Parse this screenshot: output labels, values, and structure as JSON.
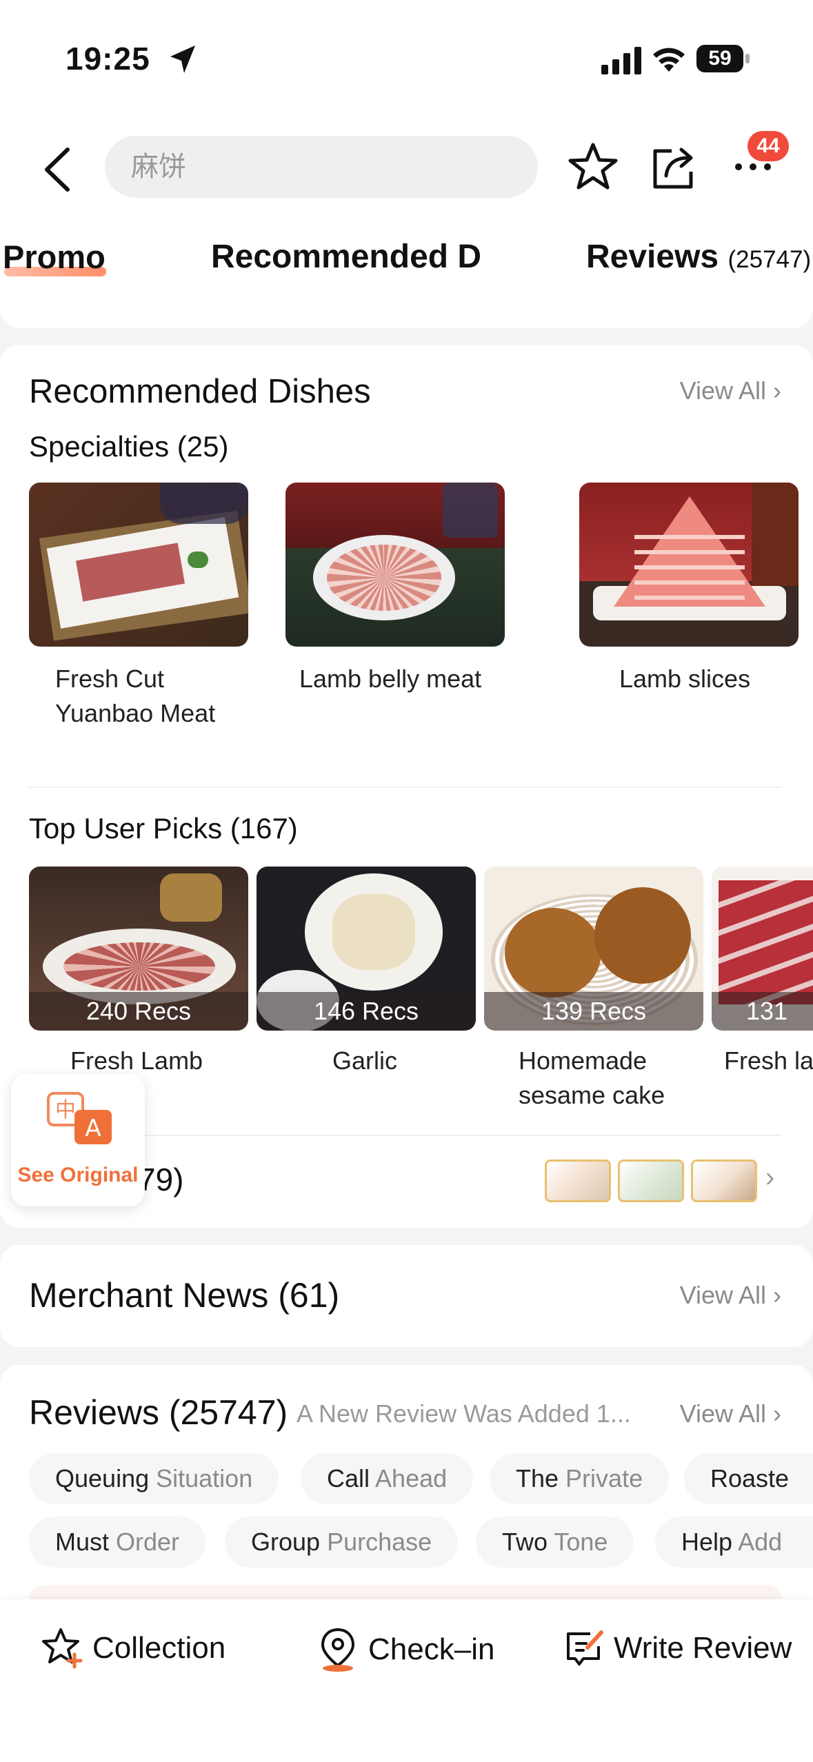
{
  "status_bar": {
    "time": "19:25",
    "battery": "59"
  },
  "header": {
    "search_placeholder": "麻饼",
    "notification_count": "44"
  },
  "tabs": [
    {
      "label": "Promo",
      "active": true
    },
    {
      "label": "Recommended D"
    },
    {
      "label": "Reviews",
      "count": "(25747)"
    }
  ],
  "recommended": {
    "title": "Recommended Dishes",
    "view_all": "View All",
    "specialties_title": "Specialties (25)",
    "specialties": [
      {
        "name_line1": "Fresh Cut",
        "name_line2": "Yuanbao Meat"
      },
      {
        "name_line1": "Lamb belly meat",
        "name_line2": ""
      },
      {
        "name_line1": "Lamb slices",
        "name_line2": ""
      }
    ],
    "top_picks_title": "Top User Picks (167)",
    "top_picks": [
      {
        "recs": "240 Recs",
        "name_line1": "Fresh Lamb",
        "name_line2": ""
      },
      {
        "recs": "146 Recs",
        "name_line1": "Garlic",
        "name_line2": ""
      },
      {
        "recs": "139 Recs",
        "name_line1": "Homemade",
        "name_line2": "sesame cake"
      },
      {
        "recs": "131",
        "name_line1": "Fresh la",
        "name_line2": ""
      }
    ],
    "menu_row_text": "79)"
  },
  "see_original": {
    "label": "See Original"
  },
  "merchant_news": {
    "title": "Merchant News (61)",
    "view_all": "View All"
  },
  "reviews": {
    "title": "Reviews (25747)",
    "subtitle": "A New Review Was Added 1...",
    "view_all": "View All",
    "chips_row1": [
      {
        "h": "Queuing",
        "l": " Situation"
      },
      {
        "h": "Call",
        "l": " Ahead"
      },
      {
        "h": "The",
        "l": " Private"
      },
      {
        "h": "Roaste",
        "l": ""
      }
    ],
    "chips_row2": [
      {
        "h": "Must",
        "l": " Order"
      },
      {
        "h": "Group",
        "l": " Purchase"
      },
      {
        "h": "Two",
        "l": " Tone"
      },
      {
        "h": "Help",
        "l": " Add"
      }
    ]
  },
  "bottom_bar": {
    "collection": "Collection",
    "checkin": "Check–in",
    "write_review": "Write Review"
  },
  "colors": {
    "accent": "#f0703a",
    "badge": "#f04a3a"
  }
}
